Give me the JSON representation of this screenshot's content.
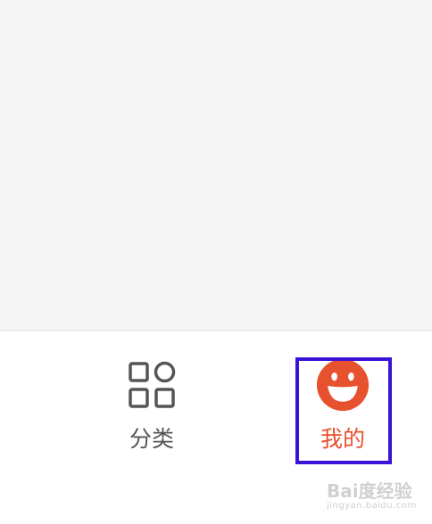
{
  "tabbar": {
    "tabs": [
      {
        "id": "category",
        "label": "分类",
        "icon": "grid-icon",
        "active": false
      },
      {
        "id": "mine",
        "label": "我的",
        "icon": "smiley-face-icon",
        "active": true
      }
    ]
  },
  "colors": {
    "active": "#e8512d",
    "inactive": "#555555",
    "highlight_border": "#3b12d8",
    "background": "#f5f5f5",
    "tabbar_background": "#ffffff"
  },
  "watermark": {
    "main": "Bai度经验",
    "sub": "jingyan.baidu.com"
  }
}
